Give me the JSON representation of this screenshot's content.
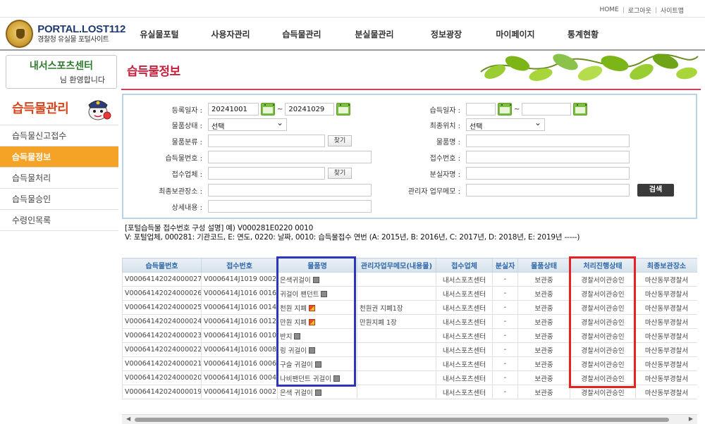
{
  "util_links": [
    "HOME",
    "로그아웃",
    "사이트맵"
  ],
  "logo": {
    "title": "PORTAL.LOST112",
    "subtitle": "경찰청 유실물 포털사이트"
  },
  "gnb": [
    "유실물포털",
    "사용자관리",
    "습득물관리",
    "분실물관리",
    "정보광장",
    "마이페이지",
    "통계현황"
  ],
  "welcome": {
    "org": "내서스포츠센터",
    "greeting": "님 환영합니다"
  },
  "side": {
    "title": "습득물관리",
    "items": [
      "습득물신고접수",
      "습득물정보",
      "습득물처리",
      "습득물승인",
      "수령인목록"
    ],
    "active_index": 1
  },
  "page_title": "습득물정보",
  "search": {
    "reg_date_label": "등록일자 :",
    "reg_date_from": "20241001",
    "reg_date_to": "20241029",
    "tilde": "~",
    "found_date_label": "습득일자 :",
    "found_date_from": "",
    "found_date_to": "",
    "status_label": "물품상태 :",
    "status_value": "선택",
    "final_loc_label": "최종위치 :",
    "final_loc_value": "선택",
    "category_label": "물품분류 :",
    "category_value": "",
    "find_label": "찾기",
    "item_name_label": "물품명 :",
    "item_name_value": "",
    "found_no_label": "습득물번호 :",
    "found_no_value": "",
    "receipt_no_label": "접수번호 :",
    "receipt_no_value": "",
    "company_label": "접수업체 :",
    "company_value": "",
    "loser_label": "분실자명 :",
    "loser_value": "",
    "storage_label": "최종보관장소 :",
    "storage_value": "",
    "memo_label": "관리자 업무메모 :",
    "memo_value": "",
    "detail_label": "상세내용 :",
    "detail_value": "",
    "search_button": "검색"
  },
  "description": {
    "line1": "[포털습득물 접수번호 구성 설명] 예) V000281E0220 0010",
    "line2": "V: 포털업체, 000281: 기관코드, E: 연도, 0220: 날짜, 0010: 습득물접수 연번 (A: 2015년, B: 2016년, C: 2017년, D: 2018년, E: 2019년 -----)"
  },
  "table": {
    "headers": [
      "습득물번호",
      "접수번호",
      "물품명",
      "관리자업무메모(내용물)",
      "접수업체",
      "분실자",
      "물품상태",
      "처리진행상태",
      "최종보관장소"
    ],
    "rows": [
      {
        "found_no": "V00064142024000027",
        "receipt_no": "V0006414J1019 0002",
        "item": "은색귀걸이",
        "icon": "photo",
        "memo": "",
        "company": "내서스포츠센터",
        "loser": "-",
        "status": "보관중",
        "progress": "경찰서이관승인",
        "storage": "마산동부경찰서"
      },
      {
        "found_no": "V00064142024000026",
        "receipt_no": "V0006414J1016 0016",
        "item": "귀걸이 팬던트",
        "icon": "photo",
        "memo": "",
        "company": "내서스포츠센터",
        "loser": "-",
        "status": "보관중",
        "progress": "경찰서이관승인",
        "storage": "마산동부경찰서"
      },
      {
        "found_no": "V00064142024000025",
        "receipt_no": "V0006414J1016 0014",
        "item": "천원 지폐",
        "icon": "flag",
        "memo": "천원권 지폐1장",
        "company": "내서스포츠센터",
        "loser": "-",
        "status": "보관중",
        "progress": "경찰서이관승인",
        "storage": "마산동부경찰서"
      },
      {
        "found_no": "V00064142024000024",
        "receipt_no": "V0006414J1016 0012",
        "item": "만원 지폐",
        "icon": "flag",
        "memo": "만원지폐 1장",
        "company": "내서스포츠센터",
        "loser": "-",
        "status": "보관중",
        "progress": "경찰서이관승인",
        "storage": "마산동부경찰서"
      },
      {
        "found_no": "V00064142024000023",
        "receipt_no": "V0006414J1016 0010",
        "item": "반지",
        "icon": "photo",
        "memo": "",
        "company": "내서스포츠센터",
        "loser": "-",
        "status": "보관중",
        "progress": "경찰서이관승인",
        "storage": "마산동부경찰서"
      },
      {
        "found_no": "V00064142024000022",
        "receipt_no": "V0006414J1016 0008",
        "item": "링 귀걸이",
        "icon": "photo",
        "memo": "",
        "company": "내서스포츠센터",
        "loser": "-",
        "status": "보관중",
        "progress": "경찰서이관승인",
        "storage": "마산동부경찰서"
      },
      {
        "found_no": "V00064142024000021",
        "receipt_no": "V0006414J1016 0006",
        "item": "구슬 귀걸이",
        "icon": "photo",
        "memo": "",
        "company": "내서스포츠센터",
        "loser": "-",
        "status": "보관중",
        "progress": "경찰서이관승인",
        "storage": "마산동부경찰서"
      },
      {
        "found_no": "V00064142024000020",
        "receipt_no": "V0006414J1016 0004",
        "item": "나비팬던트 귀걸이",
        "icon": "photo",
        "memo": "",
        "company": "내서스포츠센터",
        "loser": "-",
        "status": "보관중",
        "progress": "경찰서이관승인",
        "storage": "마산동부경찰서"
      },
      {
        "found_no": "V00064142024000019",
        "receipt_no": "V0006414J1016 0002",
        "item": "은색 귀걸이",
        "icon": "photo",
        "memo": "",
        "company": "내서스포츠센터",
        "loser": "-",
        "status": "보관중",
        "progress": "경찰서이관승인",
        "storage": "마산동부경찰서"
      }
    ]
  },
  "colors": {
    "accent_red": "#c4203d",
    "menu_active": "#f5a326",
    "header_blue": "#3068a8",
    "highlight_blue": "#2d35b8",
    "highlight_red": "#e52322"
  }
}
